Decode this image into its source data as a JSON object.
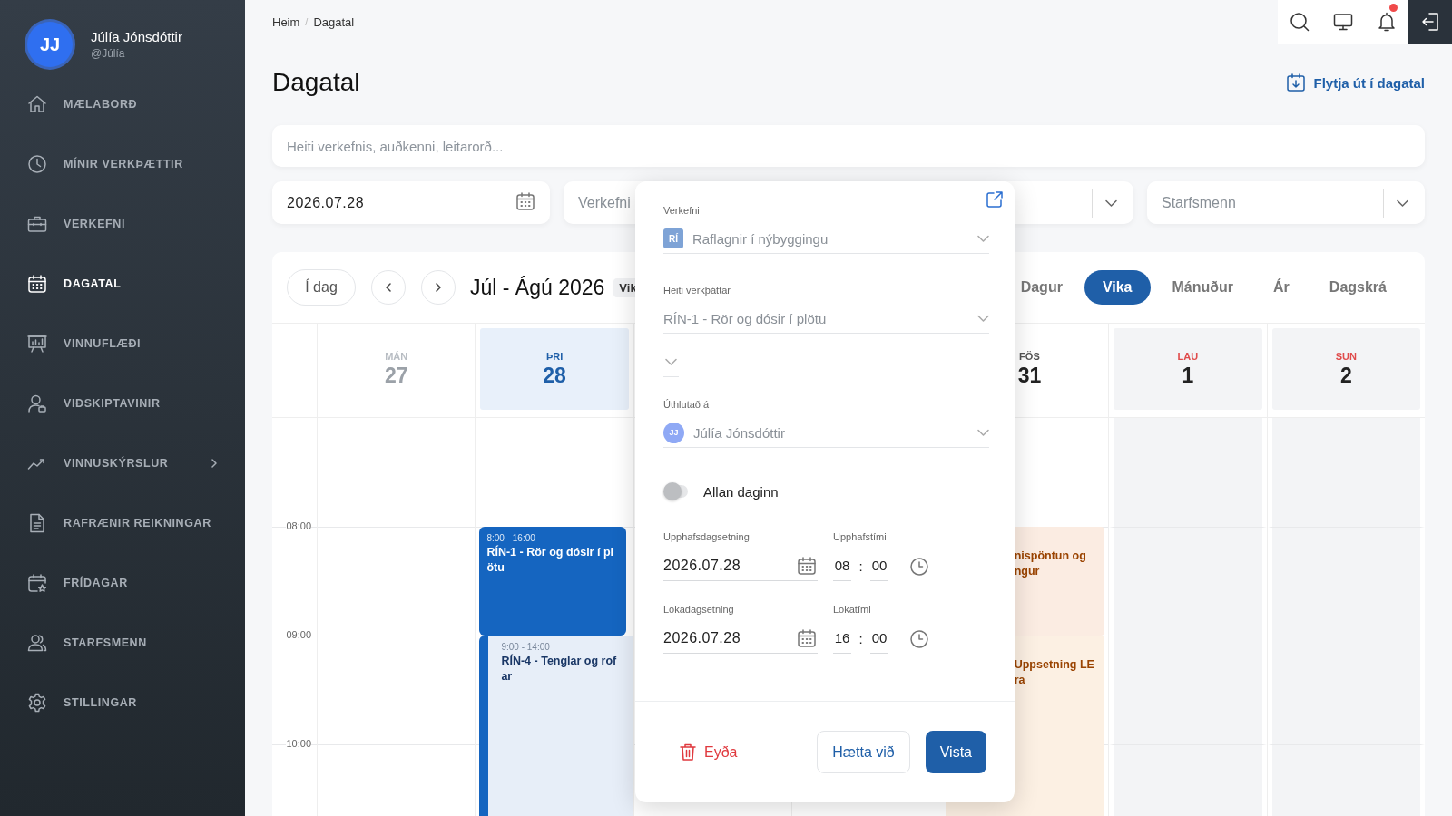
{
  "sidebar": {
    "user": {
      "initials": "JJ",
      "name": "Júlía Jónsdóttir",
      "handle": "@Júlía"
    },
    "items": [
      {
        "label": "MÆLABORÐ",
        "kind": "link",
        "selected": false
      },
      {
        "label": "MÍNIR VERKÞÆTTIR",
        "kind": "link",
        "selected": false
      },
      {
        "label": "VERKEFNI",
        "kind": "link",
        "selected": false
      },
      {
        "label": "DAGATAL",
        "kind": "link",
        "selected": true
      },
      {
        "label": "VINNUFLÆÐI",
        "kind": "link",
        "selected": false
      },
      {
        "label": "VIÐSKIPTAVINIR",
        "kind": "link",
        "selected": false
      },
      {
        "label": "VINNUSKÝRSLUR",
        "kind": "group",
        "expanded": false,
        "selected": false
      },
      {
        "label": "RAFRÆNIR REIKNINGAR",
        "kind": "link",
        "selected": false
      },
      {
        "label": "FRÍDAGAR",
        "kind": "link",
        "selected": false
      },
      {
        "label": "STARFSMENN",
        "kind": "link",
        "selected": false
      },
      {
        "label": "STILLINGAR",
        "kind": "link",
        "selected": false
      }
    ]
  },
  "topbar": {
    "unread": true
  },
  "breadcrumb": {
    "items": [
      "Heim",
      "Dagatal"
    ],
    "separator": "/"
  },
  "page": {
    "title": "Dagatal",
    "export_link": "Flytja út í dagatal"
  },
  "search": {
    "placeholder": "Heiti verkefnis, auðkenni, leitarorð..."
  },
  "filters": {
    "date": "2026.07.28",
    "project": {
      "placeholder": "Verkefni"
    },
    "employees": {
      "placeholder": "Starfsmenn"
    }
  },
  "calendar": {
    "today_button": "Í dag",
    "range_title": "Júl - Ágú 2026",
    "view_badge": "Vik",
    "views": [
      {
        "label": "Dagur",
        "selected": false
      },
      {
        "label": "Vika",
        "selected": true
      },
      {
        "label": "Mánuður",
        "selected": false
      },
      {
        "label": "Ár",
        "selected": false
      },
      {
        "label": "Dagskrá",
        "selected": false
      }
    ],
    "days": [
      {
        "kind": "day",
        "name": "MÁN",
        "number": "27",
        "past": true,
        "today": false,
        "weekend": false
      },
      {
        "kind": "day",
        "name": "ÞRI",
        "number": "28",
        "past": false,
        "today": true,
        "weekend": false,
        "events": [
          {
            "kind": "solid",
            "color": "#1565c0",
            "time": "8:00 - 16:00",
            "lines": [
              "RÍN-1 - Rör og dósir í pl",
              "ötu"
            ]
          },
          {
            "kind": "light",
            "color": "#e7eef8",
            "time": "9:00 - 14:00",
            "lines": [
              "RÍN-4 - Tenglar og rof",
              "ar"
            ]
          }
        ]
      },
      {
        "kind": "covered"
      },
      {
        "kind": "covered"
      },
      {
        "kind": "day",
        "name": "FÖS",
        "number": "31",
        "past": false,
        "today": false,
        "weekend": false,
        "events": [
          {
            "kind": "warm",
            "color": "#fbece2",
            "lines": [
              "nispöntun og",
              "ngur"
            ]
          },
          {
            "kind": "warm",
            "color": "#fcf0e3",
            "lines": [
              "Uppsetning LE",
              "ra"
            ]
          }
        ]
      },
      {
        "kind": "day",
        "name": "LAU",
        "number": "1",
        "past": false,
        "today": false,
        "weekend": true
      },
      {
        "kind": "day",
        "name": "SUN",
        "number": "2",
        "past": false,
        "today": false,
        "weekend": true
      }
    ],
    "times": [
      "08:00",
      "09:00",
      "10:00"
    ]
  },
  "popup": {
    "fields": [
      {
        "kind": "select",
        "label": "Verkefni",
        "badge": "RÍ",
        "value": "Raflagnir í nýbyggingu"
      },
      {
        "kind": "select",
        "label": "Heiti verkþáttar",
        "value": "RÍN-1 - Rör og dósir í plötu"
      },
      {
        "kind": "empty_select"
      },
      {
        "kind": "select",
        "label": "Úthlutað á",
        "avatar": "JJ",
        "value": "Júlía Jónsdóttir"
      },
      {
        "kind": "toggle",
        "label": "Allan daginn",
        "on": false
      },
      {
        "kind": "datetime",
        "date_label": "Upphafsdagsetning",
        "time_label": "Upphafstími",
        "date": "2026.07.28",
        "hour": "08",
        "separator": ":",
        "minute": "00"
      },
      {
        "kind": "datetime",
        "date_label": "Lokadagsetning",
        "time_label": "Lokatími",
        "date": "2026.07.28",
        "hour": "16",
        "separator": ":",
        "minute": "00"
      }
    ],
    "delete_button": "Eyða",
    "cancel_button": "Hætta við",
    "save_button": "Vista"
  }
}
